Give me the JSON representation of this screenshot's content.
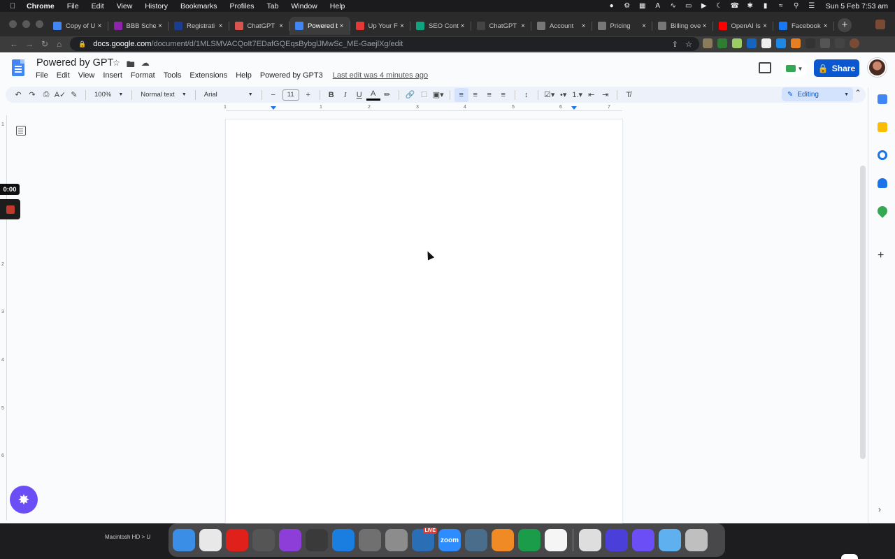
{
  "menubar": {
    "apple_icon": "apple-logo",
    "items": [
      "Chrome",
      "File",
      "Edit",
      "View",
      "History",
      "Bookmarks",
      "Profiles",
      "Tab",
      "Window",
      "Help"
    ],
    "clock": "Sun 5 Feb  7:53 am"
  },
  "tabs": [
    {
      "title": "Copy of U",
      "color": "#4285f4"
    },
    {
      "title": "BBB Sche",
      "color": "#8e24aa"
    },
    {
      "title": "Registrati",
      "color": "#1a3d8f"
    },
    {
      "title": "ChatGPT",
      "color": "#d9534f"
    },
    {
      "title": "Powered b",
      "color": "#4285f4",
      "active": true
    },
    {
      "title": "Up Your F",
      "color": "#e53935"
    },
    {
      "title": "SEO Cont",
      "color": "#10a37f"
    },
    {
      "title": "ChatGPT",
      "color": "#444444"
    },
    {
      "title": "Account",
      "color": "#777777"
    },
    {
      "title": "Pricing",
      "color": "#777777"
    },
    {
      "title": "Billing ove",
      "color": "#777777"
    },
    {
      "title": "OpenAI Is",
      "color": "#ff0000"
    },
    {
      "title": "Facebook",
      "color": "#1877f2"
    }
  ],
  "address": {
    "host": "docs.google.com",
    "path": "/document/d/1MLSMVACQoIt7EDafGQEqsBybglJMwSc_ME-GaejlXg/edit"
  },
  "doc": {
    "title": "Powered by GPT",
    "menus": [
      "File",
      "Edit",
      "View",
      "Insert",
      "Format",
      "Tools",
      "Extensions",
      "Help",
      "Powered by GPT3"
    ],
    "last_edit": "Last edit was 4 minutes ago",
    "share_label": "Share"
  },
  "toolbar": {
    "zoom": "100%",
    "style": "Normal text",
    "font": "Arial",
    "font_size": "11",
    "mode": "Editing"
  },
  "ruler": [
    "1",
    "1",
    "2",
    "3",
    "4",
    "5",
    "6",
    "7"
  ],
  "vruler": [
    "1",
    "2",
    "3",
    "4",
    "5",
    "6"
  ],
  "recording": {
    "time": "0:00"
  },
  "finder": {
    "path": "Macintosh HD > U"
  },
  "dock": {
    "apps": [
      {
        "name": "finder",
        "color": "#3a8ee6"
      },
      {
        "name": "chrome",
        "color": "#e8e8e8"
      },
      {
        "name": "opera",
        "color": "#e0201b"
      },
      {
        "name": "launchpad",
        "color": "#555555"
      },
      {
        "name": "podcasts",
        "color": "#8e3ed8"
      },
      {
        "name": "calculator",
        "color": "#3a3a3a"
      },
      {
        "name": "keynote",
        "color": "#1a7de0"
      },
      {
        "name": "script-editor",
        "color": "#707070"
      },
      {
        "name": "system-preferences",
        "color": "#8c8c8c"
      },
      {
        "name": "screenflow",
        "color": "#2a6fb5",
        "badge": "LIVE"
      },
      {
        "name": "zoom",
        "color": "#2d8cff",
        "label": "zoom"
      },
      {
        "name": "preview",
        "color": "#4a6d8c"
      },
      {
        "name": "pages",
        "color": "#f08a24"
      },
      {
        "name": "hashtag",
        "color": "#1b9c4a"
      },
      {
        "name": "notion",
        "color": "#f5f5f5"
      }
    ],
    "apps_right": [
      {
        "name": "signature",
        "color": "#dedede"
      },
      {
        "name": "vpn",
        "color": "#4a3fd8"
      },
      {
        "name": "gemini",
        "color": "#6b4ef6"
      },
      {
        "name": "downloads-folder",
        "color": "#5fb0ee"
      },
      {
        "name": "trash",
        "color": "#bfbfbf"
      }
    ]
  }
}
